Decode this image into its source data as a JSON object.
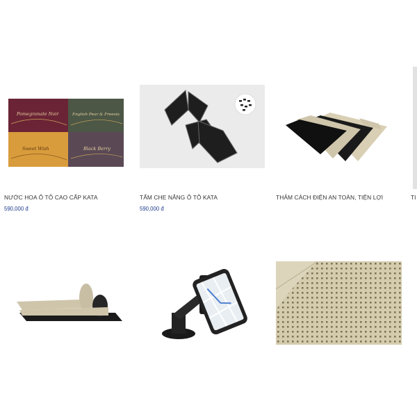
{
  "products": [
    {
      "name": "NƯỚC HOA Ô TÔ CAO CẤP KATA",
      "price": "590,000 đ",
      "image": "perfume-boxes",
      "box_labels": [
        "Pomegranate Noir",
        "English Pear & Freesia",
        "Sweet Wish",
        "Black Berry"
      ],
      "box_colors": [
        "#6b2436",
        "#4c5746",
        "#d99c3c",
        "#5a4955"
      ]
    },
    {
      "name": "TẤM CHE NẮNG Ô TÔ KATA",
      "price": "590,000 đ",
      "image": "sun-shades"
    },
    {
      "name": "THẢM CÁCH ĐIỆN AN TOÀN, TIỆN LỢI",
      "price": "",
      "image": "insulating-mats"
    },
    {
      "name": "",
      "price": "",
      "image": "rolled-mat"
    },
    {
      "name": "",
      "price": "",
      "image": "phone-holder"
    },
    {
      "name": "",
      "price": "",
      "image": "mat-texture"
    }
  ],
  "edge_partial_label": "TI",
  "colors": {
    "price": "#1f3b8a",
    "text": "#333333",
    "mat_beige": "#cfc5ab",
    "mat_black": "#1c1c1c"
  }
}
